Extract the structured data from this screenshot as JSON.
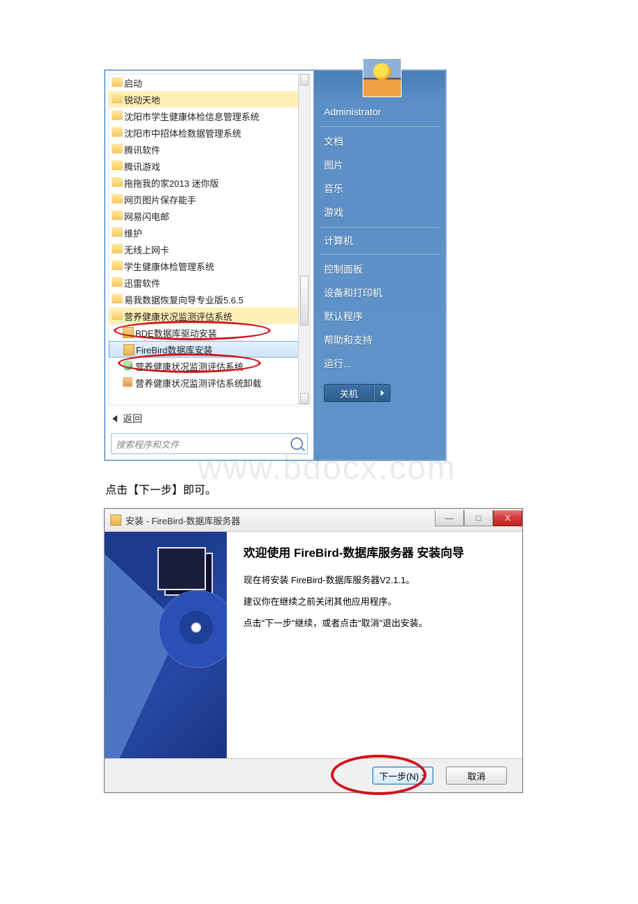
{
  "watermark": "www.bdocx.com",
  "startMenu": {
    "searchPlaceholder": "搜索程序和文件",
    "backLabel": "返回",
    "leftItems": {
      "i0": "启动",
      "i1": "锐动天地",
      "i2": "沈阳市学生健康体检信息管理系统",
      "i3": "沈阳市中招体检数据管理系统",
      "i4": "腾讯软件",
      "i5": "腾讯游戏",
      "i6": "拖拖我的家2013 迷你版",
      "i7": "网页图片保存能手",
      "i8": "网易闪电邮",
      "i9": "维护",
      "i10": "无线上网卡",
      "i11": "学生健康体检管理系统",
      "i12": "迅雷软件",
      "i13": "易我数据恢复向导专业版5.6.5",
      "i14": "营养健康状况监测评估系统",
      "i15": "BDE数据库驱动安装",
      "i16": "FireBird数据库安装",
      "i17": "营养健康状况监测评估系统",
      "i18": "营养健康状况监测评估系统卸载"
    },
    "rightItems": {
      "user": "Administrator",
      "docs": "文档",
      "pics": "图片",
      "music": "音乐",
      "games": "游戏",
      "comp": "计算机",
      "cpanel": "控制面板",
      "dev": "设备和打印机",
      "defprg": "默认程序",
      "help": "帮助和支持",
      "run": "运行..."
    },
    "shutdown": "关机"
  },
  "caption": "点击【下一步】即可。",
  "installer": {
    "title": "安装 - FireBird-数据库服务器",
    "heading": "欢迎使用 FireBird-数据库服务器 安装向导",
    "line1": "现在将安装 FireBird-数据库服务器V2.1.1。",
    "line2": "建议你在继续之前关闭其他应用程序。",
    "line3": "点击\"下一步\"继续，或者点击\"取消\"退出安装。",
    "nextBtn": "下一步(N) >",
    "cancelBtn": "取消",
    "win": {
      "min": "—",
      "max": "□",
      "close": "X"
    }
  }
}
